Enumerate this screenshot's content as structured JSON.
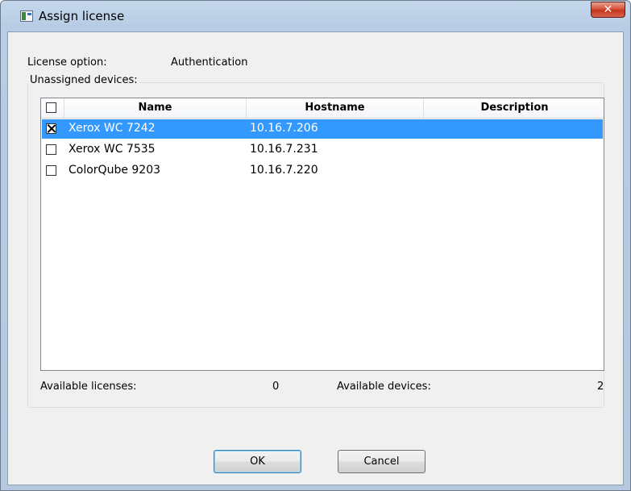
{
  "window": {
    "title": "Assign license",
    "close_label": "✕"
  },
  "license": {
    "option_label": "License option:",
    "option_value": "Authentication"
  },
  "group": {
    "title": "Unassigned devices:"
  },
  "table": {
    "columns": [
      "Name",
      "Hostname",
      "Description"
    ],
    "rows": [
      {
        "name": "Xerox WC 7242",
        "hostname": "10.16.7.206",
        "description": "",
        "checked": true,
        "selected": true
      },
      {
        "name": "Xerox WC 7535",
        "hostname": "10.16.7.231",
        "description": "",
        "checked": false,
        "selected": false
      },
      {
        "name": "ColorQube 9203",
        "hostname": "10.16.7.220",
        "description": "",
        "checked": false,
        "selected": false
      }
    ]
  },
  "summary": {
    "available_licenses_label": "Available licenses:",
    "available_licenses_value": "0",
    "available_devices_label": "Available devices:",
    "available_devices_value": "2"
  },
  "buttons": {
    "ok": "OK",
    "cancel": "Cancel"
  },
  "colors": {
    "selection": "#3399ff",
    "close_button": "#c2351c"
  }
}
